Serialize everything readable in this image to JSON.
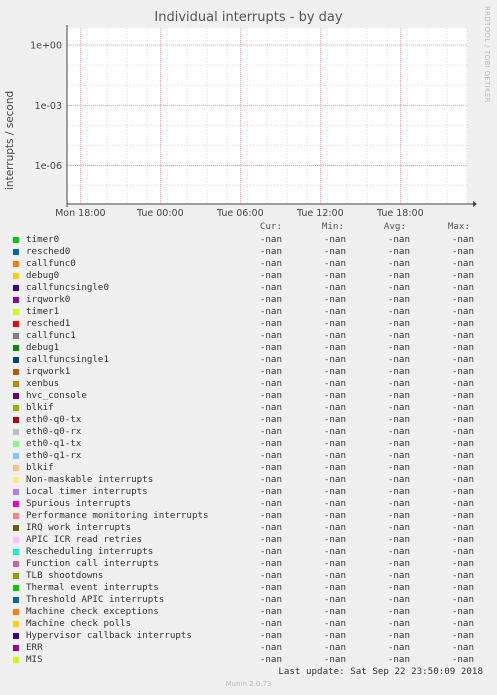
{
  "chart_data": {
    "type": "line",
    "title": "Individual interrupts - by day",
    "ylabel": "interrupts / second",
    "yscale": "log",
    "yticks": [
      "1e+00",
      "1e-03",
      "1e-06"
    ],
    "xticks": [
      "Mon 18:00",
      "Tue 00:00",
      "Tue 06:00",
      "Tue 12:00",
      "Tue 18:00"
    ],
    "grid": true,
    "series": [],
    "legend_columns": [
      "Cur:",
      "Min:",
      "Avg:",
      "Max:"
    ]
  },
  "side_label": "RRDTOOL / TOBI OETIKER",
  "legend": [
    {
      "name": "timer0",
      "color": "#00cc00",
      "cur": "-nan",
      "min": "-nan",
      "avg": "-nan",
      "max": "-nan"
    },
    {
      "name": "resched0",
      "color": "#0066b3",
      "cur": "-nan",
      "min": "-nan",
      "avg": "-nan",
      "max": "-nan"
    },
    {
      "name": "callfunc0",
      "color": "#ff8000",
      "cur": "-nan",
      "min": "-nan",
      "avg": "-nan",
      "max": "-nan"
    },
    {
      "name": "debug0",
      "color": "#ffcc00",
      "cur": "-nan",
      "min": "-nan",
      "avg": "-nan",
      "max": "-nan"
    },
    {
      "name": "callfuncsingle0",
      "color": "#330099",
      "cur": "-nan",
      "min": "-nan",
      "avg": "-nan",
      "max": "-nan"
    },
    {
      "name": "irqwork0",
      "color": "#990099",
      "cur": "-nan",
      "min": "-nan",
      "avg": "-nan",
      "max": "-nan"
    },
    {
      "name": "timer1",
      "color": "#ccff00",
      "cur": "-nan",
      "min": "-nan",
      "avg": "-nan",
      "max": "-nan"
    },
    {
      "name": "resched1",
      "color": "#ff0000",
      "cur": "-nan",
      "min": "-nan",
      "avg": "-nan",
      "max": "-nan"
    },
    {
      "name": "callfunc1",
      "color": "#808080",
      "cur": "-nan",
      "min": "-nan",
      "avg": "-nan",
      "max": "-nan"
    },
    {
      "name": "debug1",
      "color": "#008f00",
      "cur": "-nan",
      "min": "-nan",
      "avg": "-nan",
      "max": "-nan"
    },
    {
      "name": "callfuncsingle1",
      "color": "#00487d",
      "cur": "-nan",
      "min": "-nan",
      "avg": "-nan",
      "max": "-nan"
    },
    {
      "name": "irqwork1",
      "color": "#b35a00",
      "cur": "-nan",
      "min": "-nan",
      "avg": "-nan",
      "max": "-nan"
    },
    {
      "name": "xenbus",
      "color": "#b38f00",
      "cur": "-nan",
      "min": "-nan",
      "avg": "-nan",
      "max": "-nan"
    },
    {
      "name": "hvc_console",
      "color": "#6b006b",
      "cur": "-nan",
      "min": "-nan",
      "avg": "-nan",
      "max": "-nan"
    },
    {
      "name": "blkif",
      "color": "#8fb300",
      "cur": "-nan",
      "min": "-nan",
      "avg": "-nan",
      "max": "-nan"
    },
    {
      "name": "eth0-q0-tx",
      "color": "#b30000",
      "cur": "-nan",
      "min": "-nan",
      "avg": "-nan",
      "max": "-nan"
    },
    {
      "name": "eth0-q0-rx",
      "color": "#bebebe",
      "cur": "-nan",
      "min": "-nan",
      "avg": "-nan",
      "max": "-nan"
    },
    {
      "name": "eth0-q1-tx",
      "color": "#80ff80",
      "cur": "-nan",
      "min": "-nan",
      "avg": "-nan",
      "max": "-nan"
    },
    {
      "name": "eth0-q1-rx",
      "color": "#80c9ff",
      "cur": "-nan",
      "min": "-nan",
      "avg": "-nan",
      "max": "-nan"
    },
    {
      "name": "blkif",
      "color": "#ffc080",
      "cur": "-nan",
      "min": "-nan",
      "avg": "-nan",
      "max": "-nan"
    },
    {
      "name": "Non-maskable interrupts",
      "color": "#ffe680",
      "cur": "-nan",
      "min": "-nan",
      "avg": "-nan",
      "max": "-nan"
    },
    {
      "name": "Local timer interrupts",
      "color": "#aa80ff",
      "cur": "-nan",
      "min": "-nan",
      "avg": "-nan",
      "max": "-nan"
    },
    {
      "name": "Spurious interrupts",
      "color": "#ee00cc",
      "cur": "-nan",
      "min": "-nan",
      "avg": "-nan",
      "max": "-nan"
    },
    {
      "name": "Performance monitoring interrupts",
      "color": "#ff8080",
      "cur": "-nan",
      "min": "-nan",
      "avg": "-nan",
      "max": "-nan"
    },
    {
      "name": "IRQ work interrupts",
      "color": "#666600",
      "cur": "-nan",
      "min": "-nan",
      "avg": "-nan",
      "max": "-nan"
    },
    {
      "name": "APIC ICR read retries",
      "color": "#ffbfff",
      "cur": "-nan",
      "min": "-nan",
      "avg": "-nan",
      "max": "-nan"
    },
    {
      "name": "Rescheduling interrupts",
      "color": "#00ffcc",
      "cur": "-nan",
      "min": "-nan",
      "avg": "-nan",
      "max": "-nan"
    },
    {
      "name": "Function call interrupts",
      "color": "#cc6699",
      "cur": "-nan",
      "min": "-nan",
      "avg": "-nan",
      "max": "-nan"
    },
    {
      "name": "TLB shootdowns",
      "color": "#999900",
      "cur": "-nan",
      "min": "-nan",
      "avg": "-nan",
      "max": "-nan"
    },
    {
      "name": "Thermal event interrupts",
      "color": "#00cc00",
      "cur": "-nan",
      "min": "-nan",
      "avg": "-nan",
      "max": "-nan"
    },
    {
      "name": "Threshold APIC interrupts",
      "color": "#0066b3",
      "cur": "-nan",
      "min": "-nan",
      "avg": "-nan",
      "max": "-nan"
    },
    {
      "name": "Machine check exceptions",
      "color": "#ff8000",
      "cur": "-nan",
      "min": "-nan",
      "avg": "-nan",
      "max": "-nan"
    },
    {
      "name": "Machine check polls",
      "color": "#ffcc00",
      "cur": "-nan",
      "min": "-nan",
      "avg": "-nan",
      "max": "-nan"
    },
    {
      "name": "Hypervisor callback interrupts",
      "color": "#330099",
      "cur": "-nan",
      "min": "-nan",
      "avg": "-nan",
      "max": "-nan"
    },
    {
      "name": "ERR",
      "color": "#990099",
      "cur": "-nan",
      "min": "-nan",
      "avg": "-nan",
      "max": "-nan"
    },
    {
      "name": "MIS",
      "color": "#ccff00",
      "cur": "-nan",
      "min": "-nan",
      "avg": "-nan",
      "max": "-nan"
    }
  ],
  "last_update": "Last update: Sat Sep 22 23:50:09 2018",
  "footer": "Munin 2.0.73"
}
